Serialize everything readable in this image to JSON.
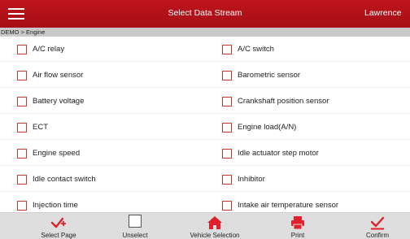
{
  "header": {
    "title": "Select Data Stream",
    "user": "Lawrence"
  },
  "breadcrumb": "DEMO > Engine",
  "items": [
    [
      "A/C relay",
      "A/C switch"
    ],
    [
      "Air flow sensor",
      "Barometric sensor"
    ],
    [
      "Battery voltage",
      "Crankshaft position sensor"
    ],
    [
      "ECT",
      "Engine load(A/N)"
    ],
    [
      "Engine speed",
      "Idle actuator step motor"
    ],
    [
      "Idle contact switch",
      "Inhibitor"
    ],
    [
      "Injection time",
      "Intake air temperature sensor"
    ]
  ],
  "toolbar": {
    "select_page": "Select Page",
    "unselect": "Unselect",
    "vehicle_selection": "Vehicle Selection",
    "print": "Print",
    "confirm": "Confirm"
  },
  "colors": {
    "accent": "#c0141c",
    "icon_red": "#e0202a"
  }
}
